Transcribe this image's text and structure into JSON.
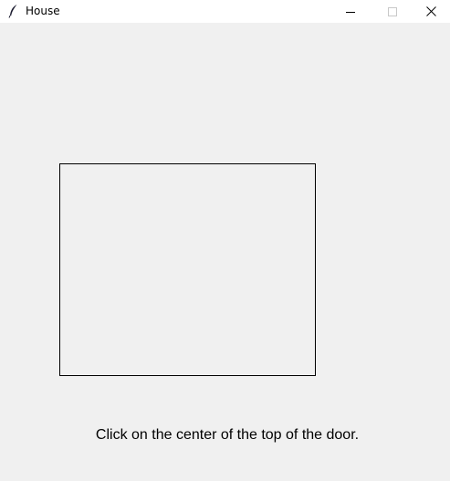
{
  "window": {
    "title": "House",
    "icon": "feather-icon",
    "controls": {
      "minimize_icon": "minimize-icon",
      "maximize_icon": "maximize-icon",
      "close_icon": "close-icon"
    }
  },
  "canvas": {
    "instruction": "Click on the center of the top of the door."
  },
  "colors": {
    "background": "#f0f0f0",
    "titlebar": "#ffffff",
    "outline": "#000000"
  }
}
